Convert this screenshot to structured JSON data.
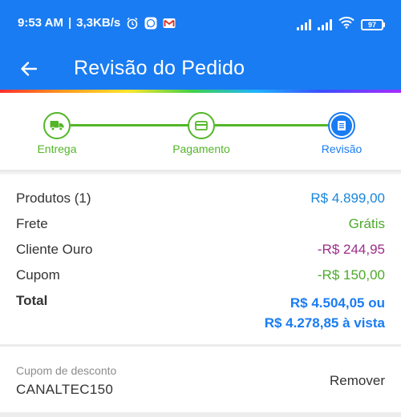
{
  "status_bar": {
    "time": "9:53 AM",
    "network_speed": "3,3KB/s",
    "battery_level": "97",
    "icons": [
      "alarm-icon",
      "whatsapp-icon",
      "gmail-icon",
      "signal-icon",
      "signal-icon",
      "wifi-icon",
      "battery-icon"
    ]
  },
  "app_bar": {
    "title": "Revisão do Pedido",
    "back_icon": "arrow-left-icon"
  },
  "colors": {
    "primary": "#1a7cf2",
    "step_done": "#52b627",
    "value_blue": "#1a86d9",
    "value_green": "#4daa2a",
    "value_purple": "#9c2e8b"
  },
  "stepper": {
    "steps": [
      {
        "label": "Entrega",
        "icon": "truck-icon",
        "state": "done"
      },
      {
        "label": "Pagamento",
        "icon": "credit-card-icon",
        "state": "done"
      },
      {
        "label": "Revisão",
        "icon": "document-icon",
        "state": "active"
      }
    ]
  },
  "summary": {
    "rows": [
      {
        "label": "Produtos (1)",
        "value": "R$ 4.899,00"
      },
      {
        "label": "Frete",
        "value": "Grátis"
      },
      {
        "label": "Cliente Ouro",
        "value": "-R$ 244,95"
      },
      {
        "label": "Cupom",
        "value": "-R$ 150,00"
      }
    ],
    "total": {
      "label": "Total",
      "value_line1": "R$ 4.504,05 ou",
      "value_line2": "R$ 4.278,85 à vista"
    }
  },
  "coupon": {
    "caption": "Cupom de desconto",
    "code": "CANALTEC150",
    "remove_label": "Remover"
  }
}
